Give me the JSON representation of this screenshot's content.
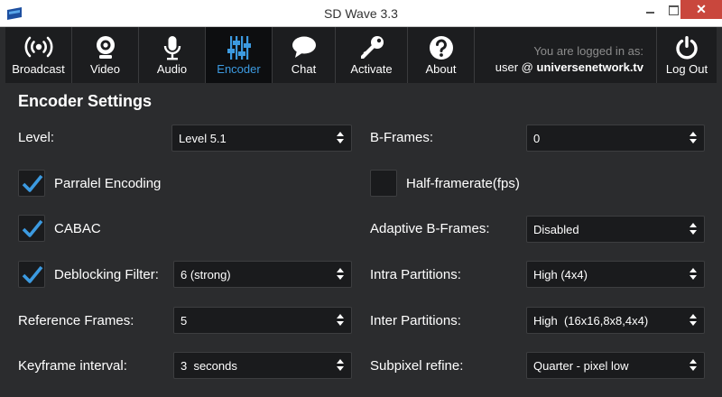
{
  "window": {
    "title": "SD Wave 3.3",
    "close_glyph": "✕"
  },
  "toolbar": {
    "items": [
      {
        "label": "Broadcast",
        "icon": "broadcast-icon"
      },
      {
        "label": "Video",
        "icon": "webcam-icon"
      },
      {
        "label": "Audio",
        "icon": "microphone-icon"
      },
      {
        "label": "Encoder",
        "icon": "sliders-icon",
        "active": true
      },
      {
        "label": "Chat",
        "icon": "chat-bubble-icon"
      },
      {
        "label": "Activate",
        "icon": "key-icon"
      },
      {
        "label": "About",
        "icon": "question-icon"
      }
    ],
    "login_line1": "You are logged in as:",
    "login_user": "user @ ",
    "login_domain": "universenetwork.tv",
    "logout_label": "Log Out"
  },
  "colors": {
    "accent": "#3c9ae0",
    "background": "#2b2c2e",
    "toolbar": "#1c1d1f",
    "close_button": "#c9473d"
  },
  "encoder": {
    "heading": "Encoder Settings",
    "level": {
      "label": "Level:",
      "value": "Level 5.1"
    },
    "b_frames": {
      "label": "B-Frames:",
      "value": "0"
    },
    "parallel_encoding": {
      "label": "Parralel Encoding",
      "checked": true
    },
    "half_framerate": {
      "label": "Half-framerate(fps)",
      "checked": false
    },
    "cabac": {
      "label": "CABAC",
      "checked": true
    },
    "adaptive_b_frames": {
      "label": "Adaptive B-Frames:",
      "value": "Disabled"
    },
    "deblocking_filter": {
      "label": "Deblocking Filter:",
      "value": "6 (strong)",
      "checked": true
    },
    "intra_partitions": {
      "label": "Intra Partitions:",
      "value": "High (4x4)"
    },
    "reference_frames": {
      "label": "Reference Frames:",
      "value": "5"
    },
    "inter_partitions": {
      "label": "Inter Partitions:",
      "value": "High  (16x16,8x8,4x4)"
    },
    "keyframe_interval": {
      "label": "Keyframe interval:",
      "value": "3  seconds"
    },
    "subpixel_refine": {
      "label": "Subpixel refine:",
      "value": "Quarter - pixel low"
    }
  }
}
